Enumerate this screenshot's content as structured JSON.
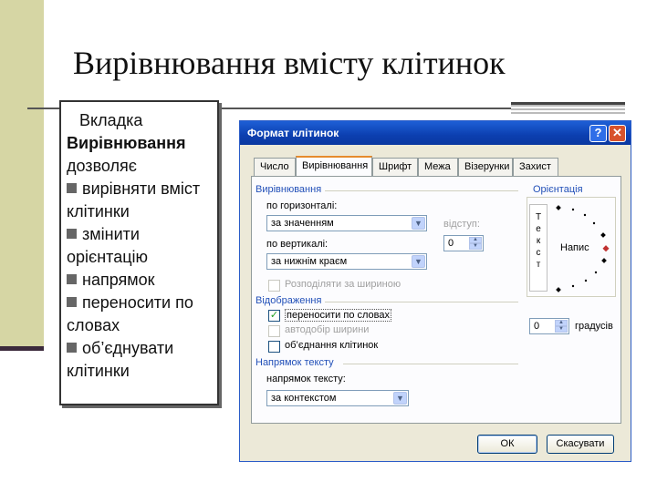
{
  "slide": {
    "title": "Вирівнювання вмісту клітинок",
    "intro_prefix": "Вкладка",
    "intro_bold": "Вирівнювання",
    "intro_suffix": "дозволяє",
    "bullets": [
      "вирівняти вміст клітинки",
      "змінити орієнтацію",
      "напрямок",
      "переносити по словах",
      "об’єднувати клітинки"
    ]
  },
  "dialog": {
    "title": "Формат клітинок",
    "help_icon": "question-icon",
    "close_icon": "close-icon",
    "tabs": [
      "Число",
      "Вирівнювання",
      "Шрифт",
      "Межа",
      "Візерунки",
      "Захист"
    ],
    "active_tab": "Вирівнювання",
    "alignment_group": "Вирівнювання",
    "horizontal_label": "по горизонталі:",
    "horizontal_value": "за значенням",
    "vertical_label": "по вертикалі:",
    "vertical_value": "за нижнім краєм",
    "indent_label": "відступ:",
    "indent_value": "0",
    "distributed_label": "Розподіляти за шириною",
    "display_group": "Відображення",
    "wrap_label": "переносити по словах",
    "wrap_checked": true,
    "autofit_label": "автодобір ширини",
    "merge_label": "об’єднання клітинок",
    "direction_group": "Напрямок тексту",
    "direction_label": "напрямок тексту:",
    "direction_value": "за контекстом",
    "orientation_group": "Орієнтація",
    "vertical_letters": [
      "Т",
      "е",
      "к",
      "с",
      "т"
    ],
    "orientation_sample": "Напис",
    "degrees_value": "0",
    "degrees_label": "градусів",
    "ok_label": "ОК",
    "cancel_label": "Скасувати"
  }
}
